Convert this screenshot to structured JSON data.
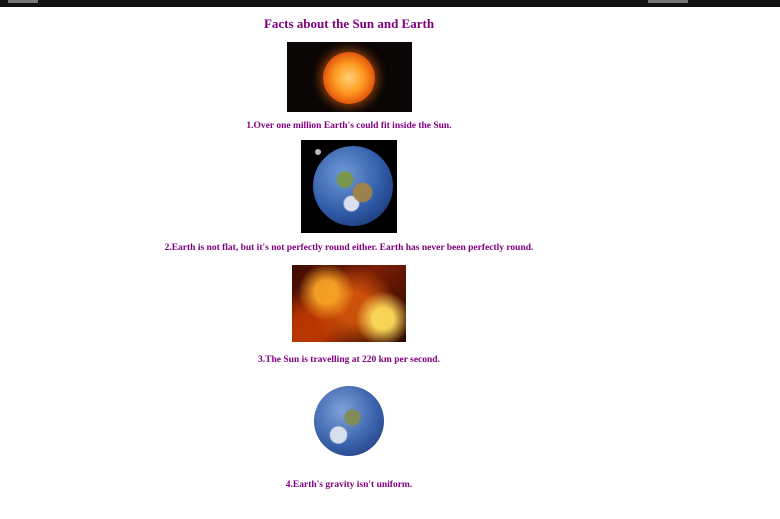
{
  "page": {
    "title": "Facts about the Sun and Earth"
  },
  "facts": [
    {
      "caption": "1.Over one million Earth's could fit inside the Sun.",
      "image": "sun-photo"
    },
    {
      "caption": "2.Earth is not flat, but it's not perfectly round either. Earth has never been perfectly round.",
      "image": "earth-photo"
    },
    {
      "caption": "3.The Sun is travelling at 220 km per second.",
      "image": "solar-surface-photo"
    },
    {
      "caption": "4.Earth's gravity isn't uniform.",
      "image": "earth-globe-photo"
    }
  ],
  "colors": {
    "text": "#800080",
    "background": "#ffffff",
    "top_bar": "#111111"
  }
}
